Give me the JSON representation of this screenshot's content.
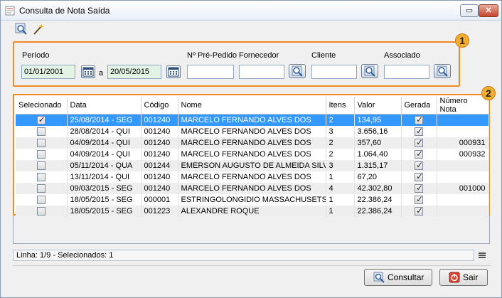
{
  "window": {
    "title": "Consulta de Nota Saída"
  },
  "filters": {
    "periodo_label": "Período",
    "date_from": "01/01/2001",
    "date_sep": "a",
    "date_to": "20/05/2015",
    "pre_pedido_label": "Nº Pré-Pedido",
    "fornecedor_label": "Fornecedor",
    "cliente_label": "Cliente",
    "associado_label": "Associado"
  },
  "callouts": {
    "one": "1",
    "two": "2"
  },
  "grid": {
    "columns": [
      "Selecionado",
      "Data",
      "Código",
      "Nome",
      "Itens",
      "Valor",
      "Gerada",
      "Número Nota"
    ],
    "rows": [
      {
        "selecionado": true,
        "data": "25/08/2014 - SEG",
        "codigo": "001240",
        "nome": "MARCELO FERNANDO ALVES DOS",
        "itens": "2",
        "valor": "134,95",
        "gerada": true,
        "numero": ""
      },
      {
        "selecionado": false,
        "data": "28/08/2014 - QUI",
        "codigo": "001240",
        "nome": "MARCELO FERNANDO ALVES DOS",
        "itens": "3",
        "valor": "3.656,16",
        "gerada": true,
        "numero": ""
      },
      {
        "selecionado": false,
        "data": "04/09/2014 - QUI",
        "codigo": "001240",
        "nome": "MARCELO FERNANDO ALVES DOS",
        "itens": "2",
        "valor": "357,60",
        "gerada": true,
        "numero": "000931"
      },
      {
        "selecionado": false,
        "data": "04/09/2014 - QUI",
        "codigo": "001240",
        "nome": "MARCELO FERNANDO ALVES DOS",
        "itens": "2",
        "valor": "1.064,40",
        "gerada": true,
        "numero": "000932"
      },
      {
        "selecionado": false,
        "data": "05/11/2014 - QUA",
        "codigo": "001244",
        "nome": "EMERSON AUGUSTO DE ALMEIDA SILVA",
        "itens": "3",
        "valor": "1.315,17",
        "gerada": true,
        "numero": ""
      },
      {
        "selecionado": false,
        "data": "13/11/2014 - QUI",
        "codigo": "001240",
        "nome": "MARCELO FERNANDO ALVES DOS",
        "itens": "1",
        "valor": "67,20",
        "gerada": true,
        "numero": ""
      },
      {
        "selecionado": false,
        "data": "09/03/2015 - SEG",
        "codigo": "001240",
        "nome": "MARCELO FERNANDO ALVES DOS",
        "itens": "4",
        "valor": "42.302,80",
        "gerada": true,
        "numero": "001000"
      },
      {
        "selecionado": false,
        "data": "18/05/2015 - SEG",
        "codigo": "000001",
        "nome": "ESTRINGOLONGIDIO MASSACHUSETS",
        "itens": "1",
        "valor": "22.386,24",
        "gerada": true,
        "numero": ""
      },
      {
        "selecionado": false,
        "data": "18/05/2015 - SEG",
        "codigo": "001223",
        "nome": "ALEXANDRE ROQUE",
        "itens": "1",
        "valor": "22.386,24",
        "gerada": true,
        "numero": ""
      }
    ]
  },
  "status": {
    "text": "Linha: 1/9 - Selecionados: 1"
  },
  "buttons": {
    "consultar": "Consultar",
    "sair": "Sair"
  },
  "colors": {
    "highlight": "#f08a24",
    "selection": "#3399ff",
    "date_field": "#e2f2e3"
  }
}
